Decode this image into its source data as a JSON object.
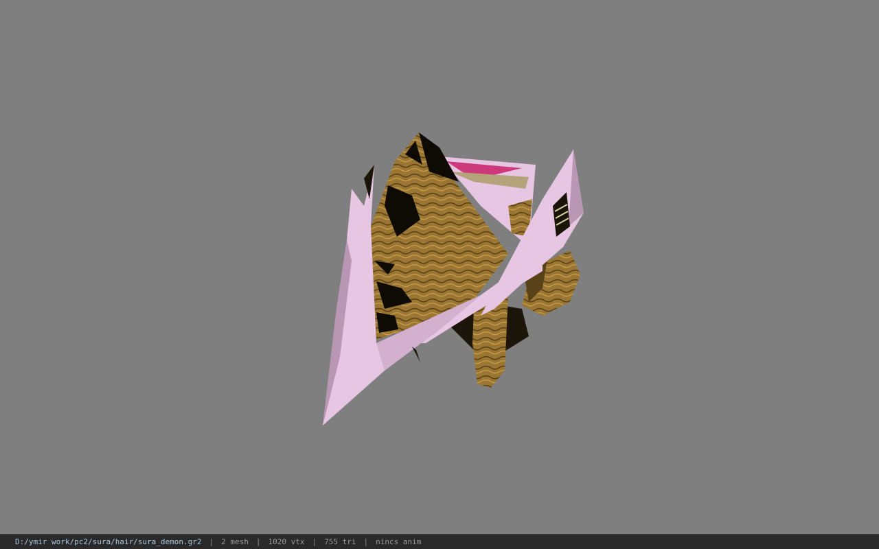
{
  "viewer": {
    "background_color": "#7f7f7f",
    "model_colors": {
      "shell": "#e6c6e2",
      "shell_shadow": "#b896b4",
      "texture_gold": "#9a7632",
      "texture_dark": "#5a4218",
      "texture_black": "#0e0a04",
      "accent_pink": "#cc3a7c"
    }
  },
  "status": {
    "file_path": "D:/ymir work/pc2/sura/hair/sura_demon.gr2",
    "separator": "|",
    "mesh_count": "2 mesh",
    "vertex_count": "1020 vtx",
    "triangle_count": "755 tri",
    "anim_status": "nincs anim"
  }
}
